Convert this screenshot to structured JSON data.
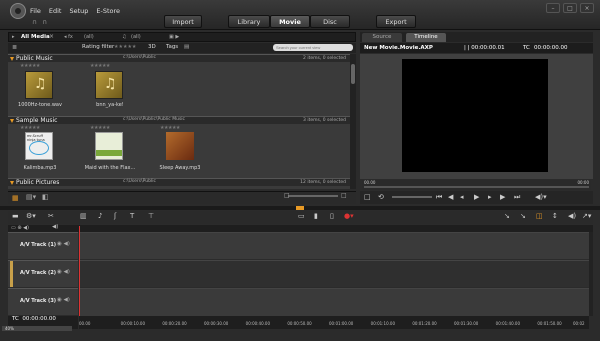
{
  "menu": [
    "File",
    "Edit",
    "Setup",
    "E-Store"
  ],
  "modes": {
    "import": "Import",
    "library": "Library",
    "movie": "Movie",
    "disc": "Disc",
    "export": "Export"
  },
  "library": {
    "tab": "All Media",
    "tab_close": "×",
    "filter_a": "(all)",
    "filter_b": "(all)",
    "rating_label": "Rating filter",
    "rating_stars": "★★★★★",
    "label_3d": "3D",
    "tags_label": "Tags",
    "search_placeholder": "Search your current view",
    "sections": [
      {
        "name": "Public Music",
        "path": "c:\\Users\\Public",
        "count": "2 items, 0 selected",
        "items": [
          {
            "name": "1000Hz-tone.wav"
          },
          {
            "name": "bnn_ya-ke!"
          }
        ]
      },
      {
        "name": "Sample Music",
        "path": "c:\\Users\\Public\\Public Music",
        "count": "3 items, 0 selected",
        "items": [
          {
            "name": "Kalimba.mp3",
            "art": "mr.Scruff\nninja tuna"
          },
          {
            "name": "Maid with the Flax..."
          },
          {
            "name": "Sleep Away.mp3"
          }
        ]
      },
      {
        "name": "Public Pictures",
        "path": "c:\\Users\\Public",
        "count": "12 items, 0 selected"
      }
    ]
  },
  "preview": {
    "tab_source": "Source",
    "tab_timeline": "Timeline",
    "title": "New Movie.Movie.AXP",
    "timecode_a": "| | 00:00:00.01",
    "timecode_b_label": "TC",
    "timecode_b": "00:00:00.00",
    "scrub_left": "00.00",
    "scrub_right": "00:00"
  },
  "timeline": {
    "tracks": [
      "A/V Track (1)",
      "A/V Track (2)",
      "A/V Track (3)"
    ],
    "tc_label": "TC",
    "tc_value": "00:00:00.00",
    "zoom": "40%",
    "ruler": [
      "00.00",
      "00:00:10.00",
      "00:00:20.00",
      "00:00:30.00",
      "00:00:40.00",
      "00:00:50.00",
      "00:01:00.00",
      "00:01:10.00",
      "00:01:20.00",
      "00:01:30.00",
      "00:01:40.00",
      "00:01:50.00",
      "00:02"
    ]
  },
  "colors": {
    "accent": "#e89a25",
    "playhead": "#dd3333"
  }
}
